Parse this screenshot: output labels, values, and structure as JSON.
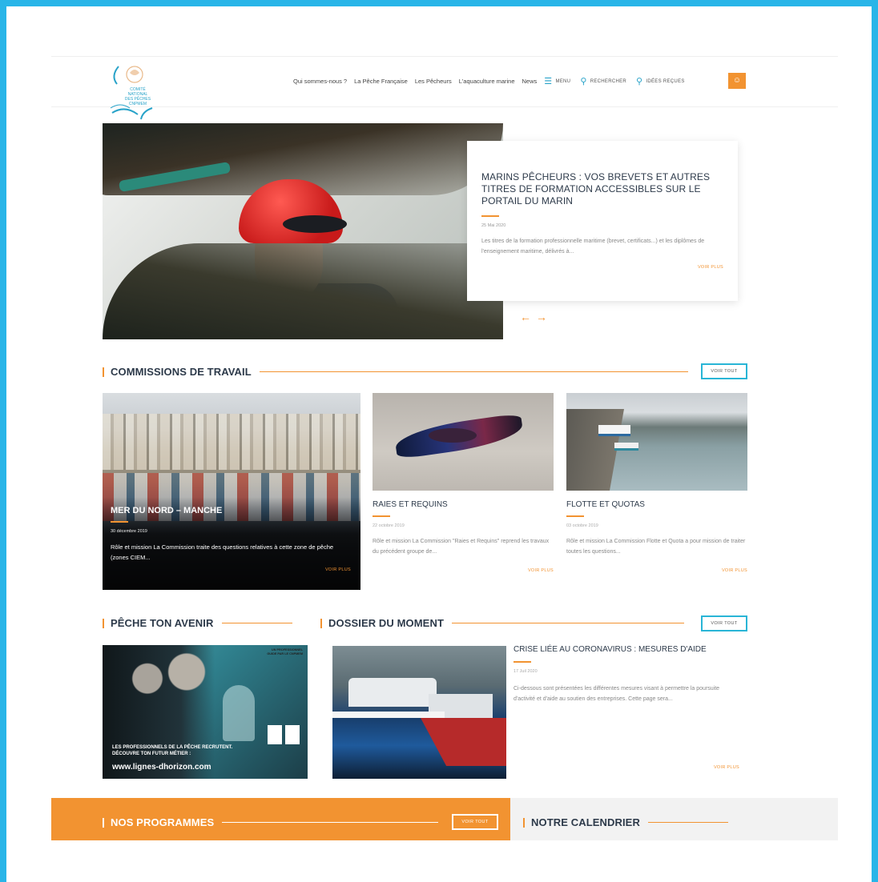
{
  "logo": {
    "text_lines": [
      "COMITÉ NATIONAL",
      "DES PÊCHES",
      "CNPMEM"
    ]
  },
  "nav": {
    "links": [
      "Qui sommes-nous ?",
      "La Pêche Française",
      "Les Pêcheurs",
      "L'aquaculture marine",
      "News"
    ],
    "menu_label": "MENU",
    "search_label": "RECHERCHER",
    "ideas_label": "IDÉES REÇUES"
  },
  "hero": {
    "title": "MARINS PÊCHEURS : VOS BREVETS ET AUTRES TITRES DE FORMATION ACCESSIBLES SUR LE PORTAIL DU MARIN",
    "date": "25 Mai 2020",
    "excerpt": "Les titres de la formation professionnelle maritime (brevet, certificats...) et les diplômes de l'enseignement maritime, délivrés à...",
    "more": "VOIR PLUS",
    "prev_arrow": "←",
    "next_arrow": "→"
  },
  "commissions": {
    "title": "COMMISSIONS DE TRAVAIL",
    "view_all": "VOIR TOUT",
    "cards": [
      {
        "title": "MER DU NORD – MANCHE",
        "date": "30 décembre 2019",
        "text": "Rôle et mission La Commission traite des questions relatives à cette zone de pêche (zones CIEM...",
        "more": "VOIR PLUS"
      },
      {
        "title": "RAIES ET REQUINS",
        "date": "22 octobre 2019",
        "text": "Rôle et mission La Commission \"Raies et Requins\" reprend les travaux du précédent groupe de...",
        "more": "VOIR PLUS"
      },
      {
        "title": "FLOTTE ET QUOTAS",
        "date": "03 octobre 2019",
        "text": "Rôle et mission La Commission Flotte et Quota a pour mission de  traiter toutes les questions...",
        "more": "VOIR PLUS"
      }
    ]
  },
  "peche": {
    "title": "PÊCHE TON AVENIR",
    "poster_top": "UN PROFESSIONNEL GUIDE PAR LE CNPMEM",
    "poster_line1": "LES PROFESSIONNELS DE LA PÊCHE RECRUTENT.",
    "poster_line2": "DÉCOUVRE TON FUTUR MÉTIER :",
    "poster_url": "www.lignes-dhorizon.com"
  },
  "dossier": {
    "title": "DOSSIER DU MOMENT",
    "view_all": "VOIR TOUT",
    "item_title": "CRISE LIÉE AU CORONAVIRUS : MESURES D'AIDE",
    "date": "17 Juil 2020",
    "text": "Ci-dessous sont présentées les différentes mesures visant à permettre la poursuite d'activité et d'aide au soutien des entreprises. Cette page sera...",
    "more": "VOIR PLUS"
  },
  "programmes": {
    "title": "NOS PROGRAMMES",
    "view_all": "VOIR TOUT"
  },
  "calendrier": {
    "title": "NOTRE CALENDRIER"
  },
  "colors": {
    "accent_orange": "#f29331",
    "accent_blue": "#29b5e8",
    "heading": "#2d3a4a"
  }
}
